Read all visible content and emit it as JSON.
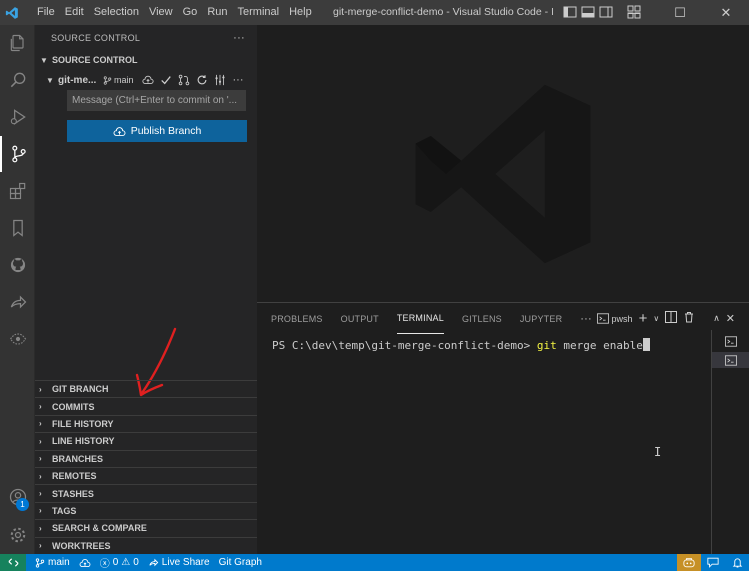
{
  "titlebar": {
    "menu": [
      "File",
      "Edit",
      "Selection",
      "View",
      "Go",
      "Run",
      "Terminal",
      "Help"
    ],
    "window_title": "git-merge-conflict-demo - Visual Studio Code - Insi...",
    "controls": {
      "minimize": "—",
      "maximize": "☐",
      "close": "✕"
    }
  },
  "sidebar": {
    "header": "SOURCE CONTROL",
    "more": "···",
    "section_title": "SOURCE CONTROL",
    "repo": {
      "name": "git-me...",
      "branch": "main"
    },
    "commit_placeholder": "Message (Ctrl+Enter to commit on '...",
    "publish_label": "Publish Branch",
    "panels": [
      "GIT BRANCH",
      "COMMITS",
      "FILE HISTORY",
      "LINE HISTORY",
      "BRANCHES",
      "REMOTES",
      "STASHES",
      "TAGS",
      "SEARCH & COMPARE",
      "WORKTREES"
    ]
  },
  "activitybar": {
    "account_badge": "1"
  },
  "panel": {
    "tabs": [
      "PROBLEMS",
      "OUTPUT",
      "TERMINAL",
      "GITLENS",
      "JUPYTER"
    ],
    "more": "···",
    "shell": "pwsh",
    "terminal": {
      "prompt": "PS C:\\dev\\temp\\git-merge-conflict-demo> ",
      "command": "git",
      "args": " merge enable"
    }
  },
  "statusbar": {
    "branch": "main",
    "problems": "0",
    "warnings": "0",
    "live_share": "Live Share",
    "git_graph": "Git Graph"
  },
  "colors": {
    "accent": "#007acc",
    "button": "#0e639c",
    "remote": "#16825d",
    "annotation": "#e02020"
  }
}
